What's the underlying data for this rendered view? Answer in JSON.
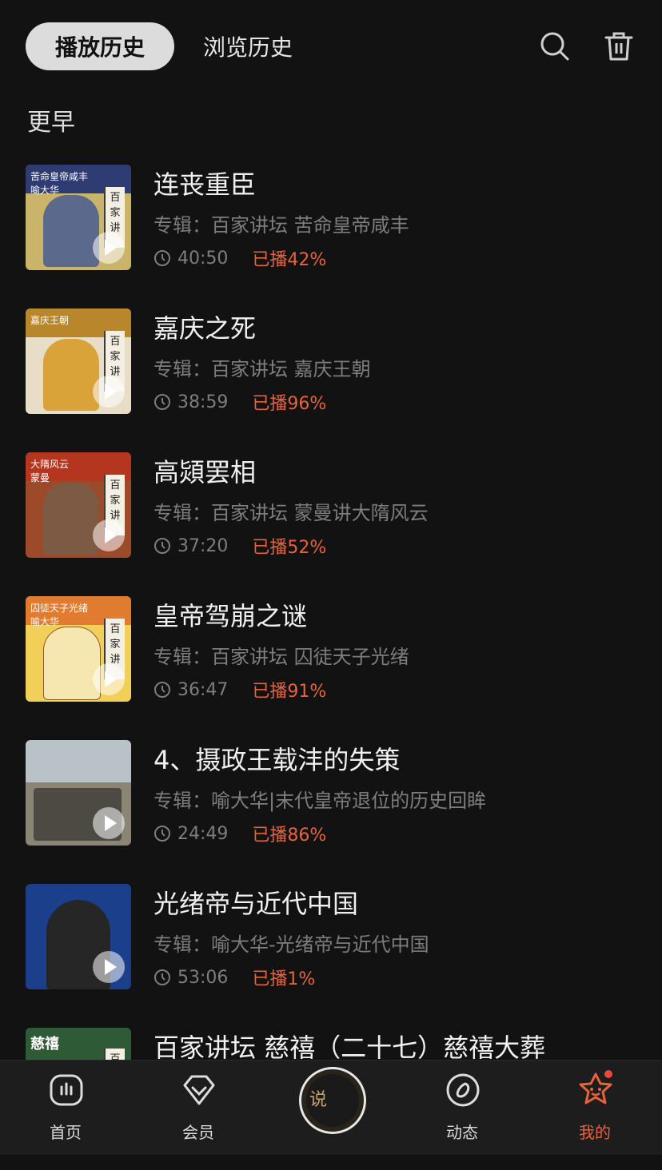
{
  "header": {
    "tabs": [
      {
        "label": "播放历史",
        "active": true
      },
      {
        "label": "浏览历史",
        "active": false
      }
    ],
    "icons": [
      "search-icon",
      "trash-icon"
    ]
  },
  "section": {
    "title": "更早"
  },
  "items": [
    {
      "title": "连丧重臣",
      "album": "专辑：百家讲坛 苦命皇帝咸丰",
      "duration": "40:50",
      "progress": "已播42%",
      "thumb": {
        "band": "苦命皇帝咸丰\n喻大华",
        "scroll": "百家讲坛",
        "bg": "#c9b46a",
        "band_bg": "#2f3b73"
      }
    },
    {
      "title": "嘉庆之死",
      "album": "专辑：百家讲坛 嘉庆王朝",
      "duration": "38:59",
      "progress": "已播96%",
      "thumb": {
        "band": "嘉庆王朝",
        "scroll": "百家讲坛",
        "bg": "#e8ddc6",
        "band_bg": "#b8872c"
      }
    },
    {
      "title": "高熲罢相",
      "album": "专辑：百家讲坛 蒙曼讲大隋风云",
      "duration": "37:20",
      "progress": "已播52%",
      "thumb": {
        "band": "大隋风云\n蒙曼",
        "scroll": "百家讲坛",
        "bg": "#9c4a2a",
        "band_bg": "#b5361f"
      }
    },
    {
      "title": "皇帝驾崩之谜",
      "album": "专辑：百家讲坛 囚徒天子光绪",
      "duration": "36:47",
      "progress": "已播91%",
      "thumb": {
        "band": "囚徒天子光绪\n喻大华",
        "scroll": "百家讲坛",
        "bg": "#f2cf58",
        "band_bg": "#e07b2f"
      }
    },
    {
      "title": "4、摄政王载沣的失策",
      "album": "专辑：喻大华|末代皇帝退位的历史回眸",
      "duration": "24:49",
      "progress": "已播86%",
      "thumb": {
        "band": "",
        "scroll": "",
        "bg": "#8a8575",
        "band_bg": "#b9c2c7"
      }
    },
    {
      "title": "光绪帝与近代中国",
      "album": "专辑：喻大华-光绪帝与近代中国",
      "duration": "53:06",
      "progress": "已播1%",
      "thumb": {
        "band": "",
        "scroll": "",
        "bg": "#1c3f8c",
        "band_bg": "#173472"
      }
    },
    {
      "title": "百家讲坛 慈禧（二十七）慈禧大葬",
      "album": "",
      "duration": "",
      "progress": "",
      "thumb": {
        "band": "慈禧",
        "scroll": "百",
        "bg": "#2f5a36",
        "band_bg": "#2f5a36"
      }
    }
  ],
  "bottom_nav": [
    {
      "label": "首页",
      "icon": "home-icon"
    },
    {
      "label": "会员",
      "icon": "vip-icon"
    },
    {
      "label": "",
      "icon": "player-disc"
    },
    {
      "label": "动态",
      "icon": "feed-icon"
    },
    {
      "label": "我的",
      "icon": "profile-icon",
      "active": true
    }
  ],
  "colors": {
    "accent": "#e8623a",
    "background": "#121212",
    "secondary_text": "#7d7d7d"
  }
}
